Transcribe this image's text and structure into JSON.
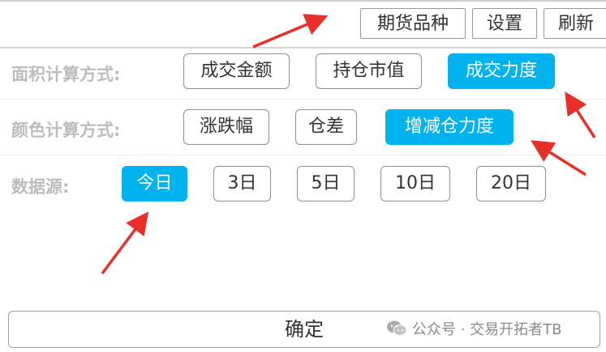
{
  "toolbar": {
    "futures_variety_label": "期货品种",
    "settings_label": "设置",
    "refresh_label": "刷新"
  },
  "area_calc": {
    "label": "面积计算方式:",
    "options": [
      "成交金额",
      "持仓市值",
      "成交力度"
    ],
    "selected": "成交力度"
  },
  "color_calc": {
    "label": "颜色计算方式:",
    "options": [
      "涨跌幅",
      "仓差",
      "增减仓力度"
    ],
    "selected": "增减仓力度"
  },
  "data_source": {
    "label": "数据源:",
    "options": [
      "今日",
      "3日",
      "5日",
      "10日",
      "20日"
    ],
    "selected": "今日"
  },
  "confirm_label": "确定",
  "watermark": {
    "text": "公众号 · 交易开拓者TB",
    "icon": "wechat-icon"
  },
  "colors": {
    "accent": "#00b2ee",
    "arrow": "#e8302a",
    "label_gray": "#bcbcbc"
  }
}
